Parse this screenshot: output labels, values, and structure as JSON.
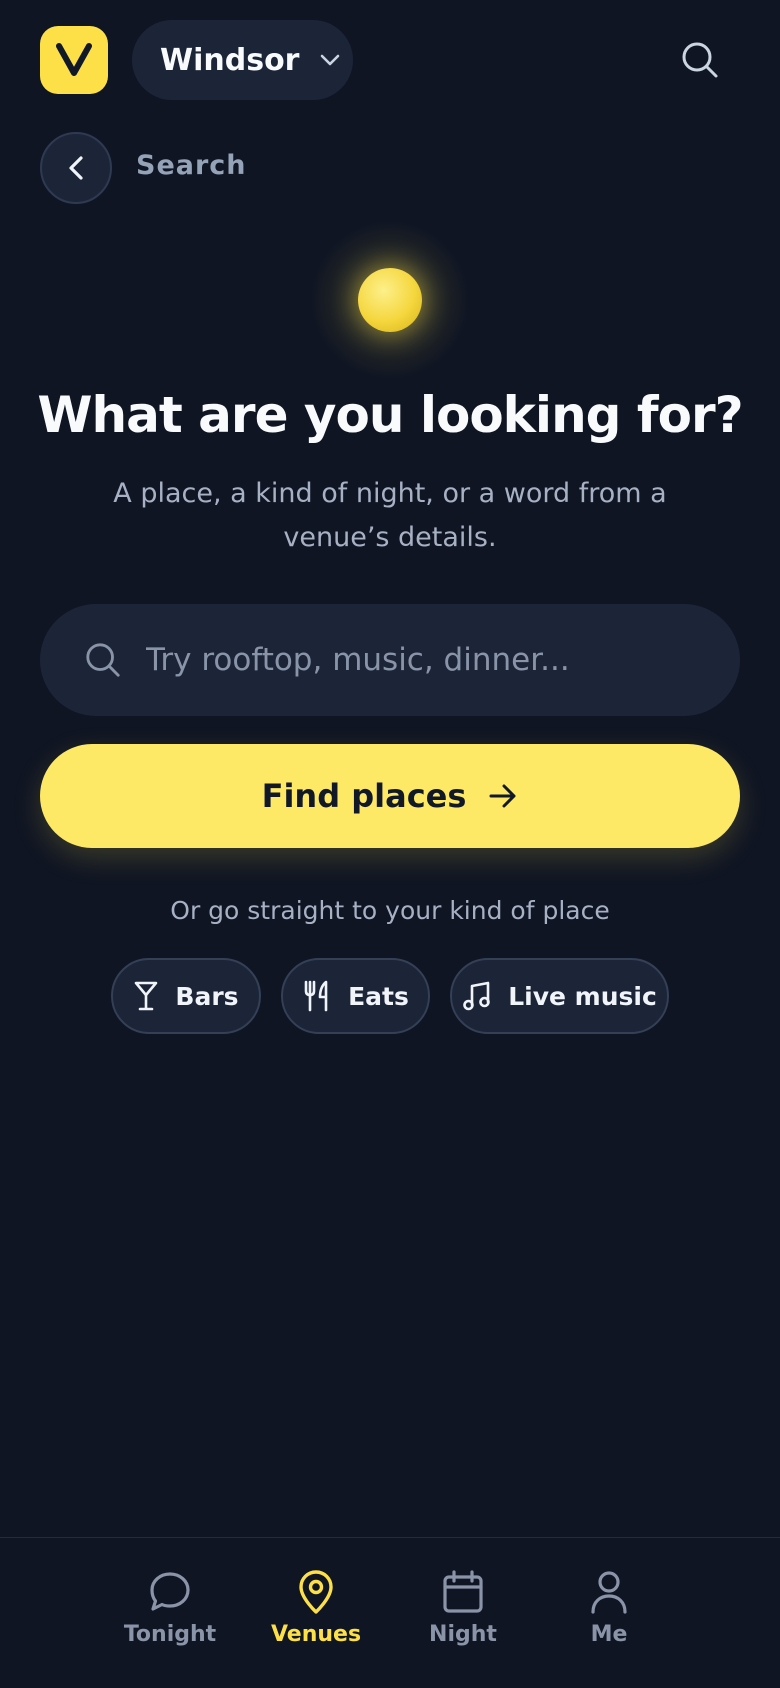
{
  "header": {
    "logo_letter": "V",
    "city": "Windsor"
  },
  "back": {
    "label": "Search"
  },
  "hero": {
    "title": "What are you looking for?",
    "subtitle": "A place, a kind of night, or a word from a venue’s details."
  },
  "search": {
    "placeholder": "Try rooftop, music, dinner...",
    "value": ""
  },
  "find_button": {
    "label": "Find places"
  },
  "shortcuts": {
    "heading": "Or go straight to your kind of place",
    "chips": [
      {
        "label": "Bars",
        "icon": "cocktail-glass-icon"
      },
      {
        "label": "Eats",
        "icon": "fork-knife-icon"
      },
      {
        "label": "Live music",
        "icon": "music-note-icon"
      }
    ]
  },
  "nav": {
    "items": [
      {
        "label": "Tonight",
        "icon": "chat-bubble-icon",
        "active": false
      },
      {
        "label": "Venues",
        "icon": "map-pin-icon",
        "active": true
      },
      {
        "label": "Night",
        "icon": "calendar-icon",
        "active": false
      },
      {
        "label": "Me",
        "icon": "person-icon",
        "active": false
      }
    ]
  },
  "colors": {
    "background": "#0f1523",
    "surface": "#1c2538",
    "accent": "#fde047",
    "muted_text": "#a7b1c4"
  }
}
